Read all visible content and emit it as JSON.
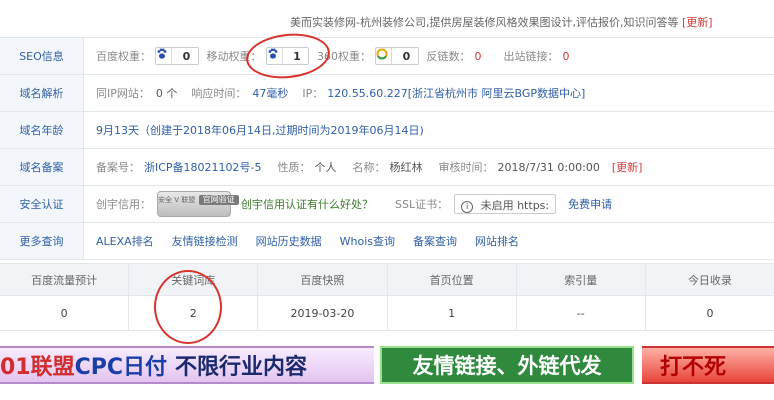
{
  "top": {
    "desc": "美而实装修网-杭州装修公司,提供房屋装修风格效果图设计,评估报价,知识问答等",
    "update": "[更新]"
  },
  "seo": {
    "label": "SEO信息",
    "baidu_label": "百度权重：",
    "baidu_value": "0",
    "mobile_label": "移动权重：",
    "mobile_value": "1",
    "s360_label": "360权重：",
    "s360_value": "0",
    "backlinks_label": "反链数：",
    "backlinks_value": "0",
    "outlinks_label": "出站链接：",
    "outlinks_value": "0"
  },
  "dns": {
    "label": "域名解析",
    "sameip_label": "同IP网站：",
    "sameip_value": "0 个",
    "resp_label": "响应时间：",
    "resp_value": "47毫秒",
    "ip_label": "IP：",
    "ip_value": "120.55.60.227[浙江省杭州市 阿里云BGP数据中心]"
  },
  "age": {
    "label": "域名年龄",
    "value": "9月13天（创建于2018年06月14日,过期时间为2019年06月14日)"
  },
  "icp": {
    "label": "域名备案",
    "no_label": "备案号：",
    "no_value": "浙ICP备18021102号-5",
    "nature_label": "性质：",
    "nature_value": "个人",
    "name_label": "名称：",
    "name_value": "杨红林",
    "audit_label": "审核时间：",
    "audit_value": "2018/7/31 0:00:00",
    "update": "[更新]"
  },
  "security": {
    "label": "安全认证",
    "credit_label": "创宇信用：",
    "stamp_top": "安全 V 联盟",
    "stamp_bottom": "官网验证",
    "credit_link": "创宇信用认证有什么好处？",
    "ssl_label": "SSL证书：",
    "ssl_value": "未启用 https:",
    "apply": "免费申请"
  },
  "more": {
    "label": "更多查询",
    "links": [
      "ALEXA排名",
      "友情链接检测",
      "网站历史数据",
      "Whois查询",
      "备案查询",
      "网站排名"
    ]
  },
  "stats": {
    "headers": [
      "百度流量预计",
      "关键词库",
      "百度快照",
      "首页位置",
      "索引量",
      "今日收录"
    ],
    "values": [
      "0",
      "2",
      "2019-03-20",
      "1",
      "--",
      "0"
    ]
  },
  "banners": {
    "b1_p1": "01联盟",
    "b1_p2": "CPC日付",
    "b1_p3": "不限行业内容",
    "b2": "友情链接、外链代发",
    "b3": "打不死"
  },
  "colors": {
    "link_blue": "#2f5fa8",
    "alert_red": "#d23b3b",
    "annotation_red": "#d8342d"
  }
}
